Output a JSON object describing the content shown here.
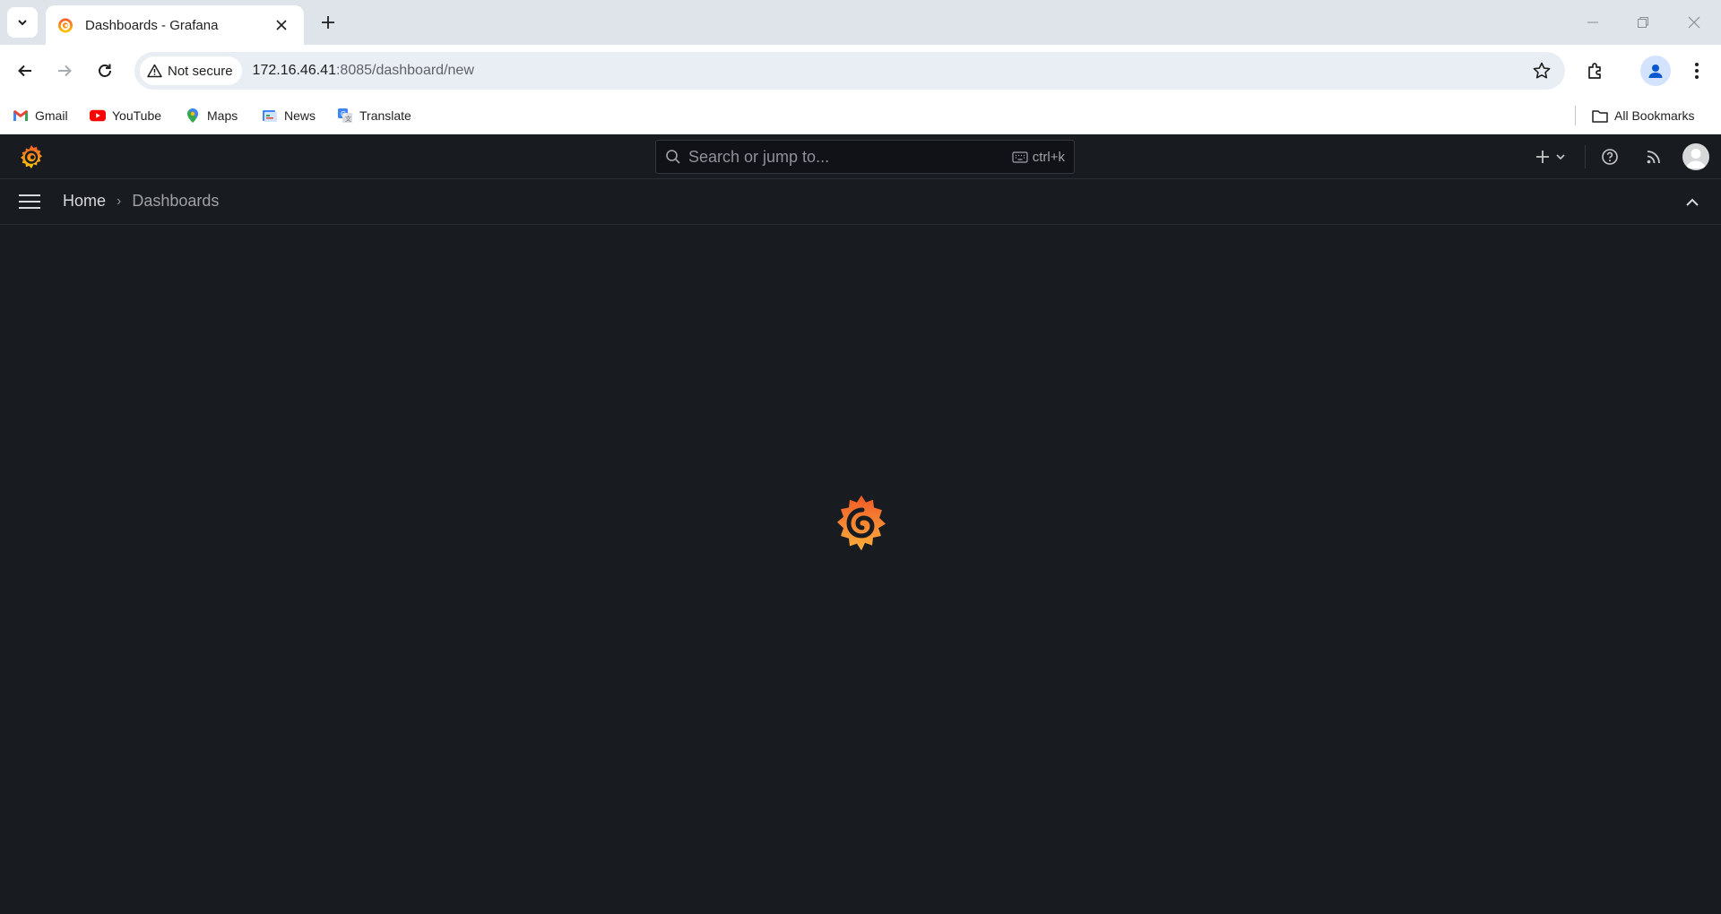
{
  "browser": {
    "tab": {
      "title": "Dashboards - Grafana"
    },
    "address": {
      "security_label": "Not secure",
      "url_host": "172.16.46.41",
      "url_rest": ":8085/dashboard/new"
    },
    "bookmarks": [
      {
        "label": "Gmail",
        "icon": "gmail-icon"
      },
      {
        "label": "YouTube",
        "icon": "youtube-icon"
      },
      {
        "label": "Maps",
        "icon": "maps-icon"
      },
      {
        "label": "News",
        "icon": "news-icon"
      },
      {
        "label": "Translate",
        "icon": "translate-icon"
      }
    ],
    "all_bookmarks_label": "All Bookmarks"
  },
  "grafana": {
    "search": {
      "placeholder": "Search or jump to...",
      "shortcut": "ctrl+k"
    },
    "breadcrumb": {
      "home": "Home",
      "current": "Dashboards"
    },
    "colors": {
      "background": "#181b1f",
      "brand_orange": "#f46800",
      "brand_yellow": "#fbb03b"
    },
    "state": "loading"
  }
}
